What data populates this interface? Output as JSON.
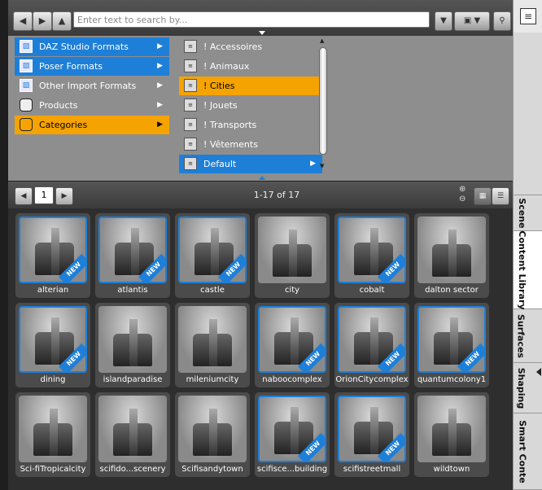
{
  "toolbar": {
    "back_icon": "arrow-left",
    "forward_icon": "arrow-right",
    "up_icon": "arrow-up",
    "search_placeholder": "Enter text to search by...",
    "search_value": ""
  },
  "tree": {
    "left": [
      {
        "label": "DAZ Studio Formats",
        "state": "blue",
        "icon": "folder-icon"
      },
      {
        "label": "Poser Formats",
        "state": "blue",
        "icon": "folder-icon"
      },
      {
        "label": "Other Import Formats",
        "state": "none",
        "icon": "folder-icon"
      },
      {
        "label": "Products",
        "state": "none",
        "icon": "database-icon"
      },
      {
        "label": "Categories",
        "state": "orange",
        "icon": "database-icon"
      }
    ],
    "middle": [
      {
        "label": "! Accessoires",
        "state": "none"
      },
      {
        "label": "! Animaux",
        "state": "none"
      },
      {
        "label": "! Cities",
        "state": "orange"
      },
      {
        "label": "! Jouets",
        "state": "none"
      },
      {
        "label": "! Transports",
        "state": "none"
      },
      {
        "label": "! Vêtements",
        "state": "none"
      },
      {
        "label": "Default",
        "state": "blue"
      }
    ]
  },
  "pager": {
    "page": "1",
    "range": "1-17 of 17"
  },
  "tabs": [
    {
      "label": "Scene",
      "active": false
    },
    {
      "label": "Content Library",
      "active": true
    },
    {
      "label": "Surfaces",
      "active": false
    },
    {
      "label": "Shaping",
      "active": false
    },
    {
      "label": "Smart Conte",
      "active": false
    }
  ],
  "items": [
    {
      "label": "alterian",
      "new": true
    },
    {
      "label": "atlantis",
      "new": true
    },
    {
      "label": "castle",
      "new": true
    },
    {
      "label": "city",
      "new": false
    },
    {
      "label": "cobalt",
      "new": true
    },
    {
      "label": "dalton sector",
      "new": false
    },
    {
      "label": "dining",
      "new": true
    },
    {
      "label": "islandparadise",
      "new": false
    },
    {
      "label": "mileniumcity",
      "new": false
    },
    {
      "label": "naboocomplex",
      "new": true
    },
    {
      "label": "OrionCitycomplex",
      "new": true
    },
    {
      "label": "quantumcolony1",
      "new": true
    },
    {
      "label": "Sci-fiTropicalcity",
      "new": false
    },
    {
      "label": "scifido...scenery",
      "new": false
    },
    {
      "label": "Scifisandytown",
      "new": false
    },
    {
      "label": "scifisce...building",
      "new": true
    },
    {
      "label": "scifistreetmall",
      "new": true
    },
    {
      "label": "wildtown",
      "new": false
    }
  ],
  "new_badge": "NEW",
  "colors": {
    "select_blue": "#1e7fd8",
    "select_orange": "#f5a300",
    "panel_gray": "#8e8e8e"
  }
}
